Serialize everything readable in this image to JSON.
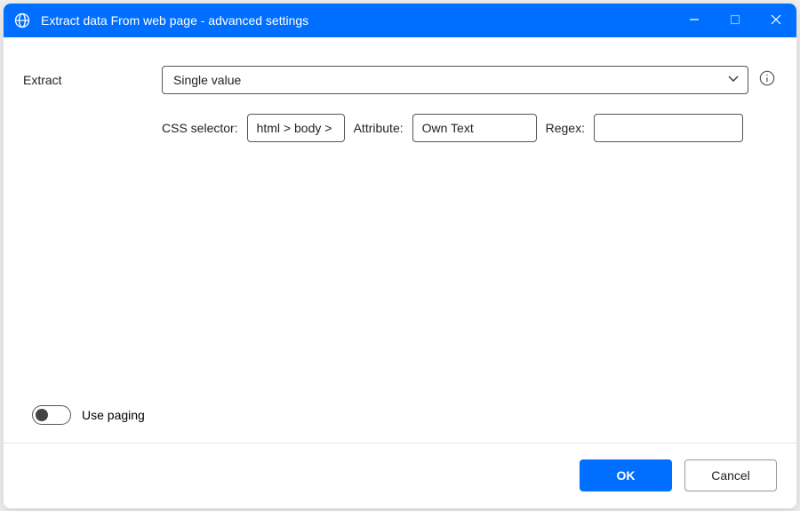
{
  "window": {
    "title": "Extract data From web page - advanced settings"
  },
  "form": {
    "extract_label": "Extract",
    "extract_value": "Single value",
    "css_selector_label": "CSS selector:",
    "css_selector_value": "html > body >",
    "attribute_label": "Attribute:",
    "attribute_value": "Own Text",
    "regex_label": "Regex:",
    "regex_value": ""
  },
  "toggle": {
    "paging_label": "Use paging",
    "paging_on": false
  },
  "footer": {
    "ok_label": "OK",
    "cancel_label": "Cancel"
  }
}
